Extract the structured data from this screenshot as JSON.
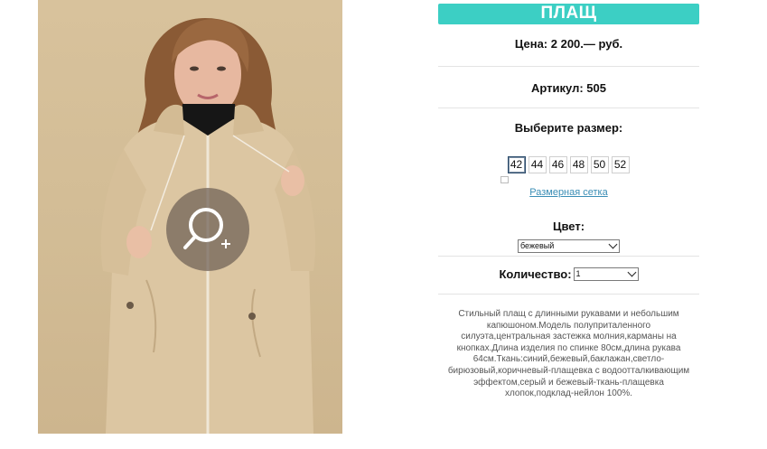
{
  "product": {
    "title": "ПЛАЩ",
    "price_label": "Цена: 2 200.— руб.",
    "sku_label": "Артикул: 505",
    "size_prompt": "Выберите размер:",
    "sizes": [
      "42",
      "44",
      "46",
      "48",
      "50",
      "52"
    ],
    "selected_size": "42",
    "size_chart_link": "Размерная сетка",
    "color_label": "Цвет:",
    "color_value": "бежевый",
    "quantity_label": "Количество:",
    "quantity_value": "1",
    "description": "Стильный плащ с длинными рукавами и небольшим капюшоном.Модель полуприталенного силуэта,центральная застежка молния,карманы на кнопках.Длина изделия по спинке 80см,длина рукава 64см.Ткань:синий,бежевый,баклажан,светло-бирюзовый,коричневый-плащевка с водоотталкивающим эффектом,серый и бежевый-ткань-плащевка хлопок,подклад-нейлон 100%."
  },
  "icons": {
    "zoom": "zoom-in-icon",
    "select_arrow": "chevron-down-icon"
  },
  "colors": {
    "accent": "#3ccfc4",
    "link": "#3a8db5",
    "coat": "#dcc6a2",
    "background_photo": "#d8c29c"
  }
}
